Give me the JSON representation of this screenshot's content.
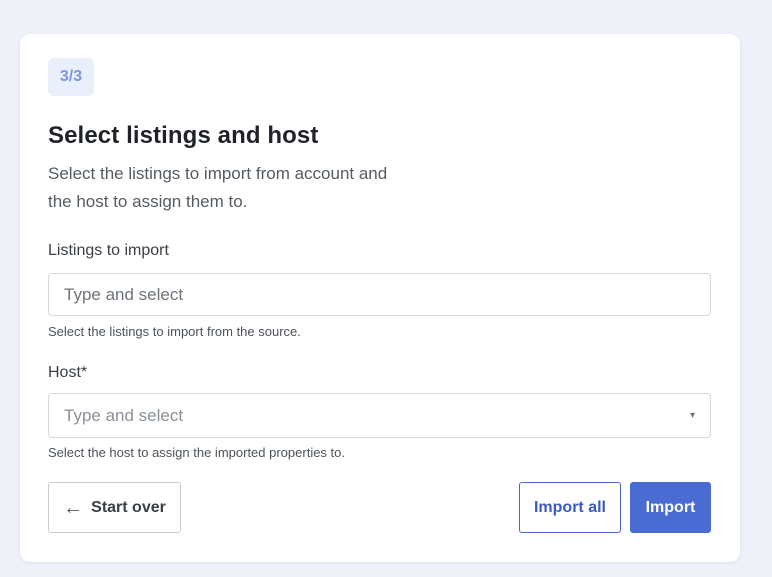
{
  "step": {
    "label": "3/3"
  },
  "header": {
    "title": "Select listings and host",
    "subtitle": "Select the listings to import from account and the host to assign them to."
  },
  "listings": {
    "label": "Listings to import",
    "placeholder": "Type and select",
    "help": "Select the listings to import from the source."
  },
  "host": {
    "label": "Host*",
    "placeholder": "Type and select",
    "help": "Select the host to assign the imported properties to."
  },
  "actions": {
    "start_over": "Start over",
    "import_all": "Import all",
    "import": "Import"
  },
  "colors": {
    "accent": "#4a6bd1",
    "badge_bg": "#eaf0fb",
    "badge_text": "#7c97d8",
    "page_bg": "#eef1f8"
  }
}
